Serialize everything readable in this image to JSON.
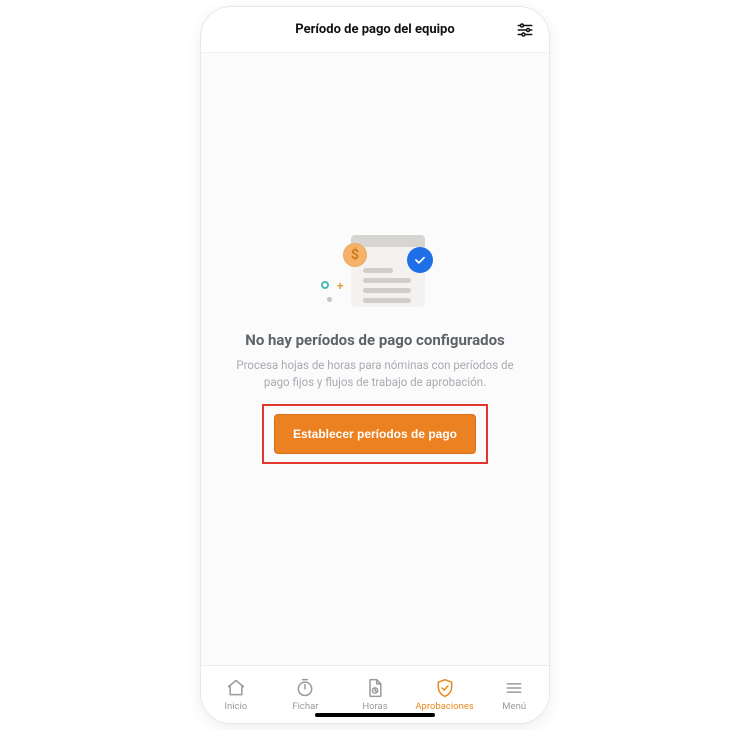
{
  "header": {
    "title": "Período de pago del equipo"
  },
  "empty_state": {
    "title": "No hay períodos de pago configurados",
    "subtitle": "Procesa hojas de horas para nóminas con períodos de pago fijos y flujos de trabajo de aprobación.",
    "cta_label": "Establecer períodos de pago"
  },
  "tabs": {
    "home": {
      "label": "Inicio"
    },
    "clock": {
      "label": "Fichar"
    },
    "hours": {
      "label": "Horas"
    },
    "approvals": {
      "label": "Aprobaciones"
    },
    "menu": {
      "label": "Menú"
    }
  },
  "colors": {
    "accent": "#ec8122",
    "highlight_border": "#e1372e",
    "check_badge": "#1f6fe8"
  }
}
